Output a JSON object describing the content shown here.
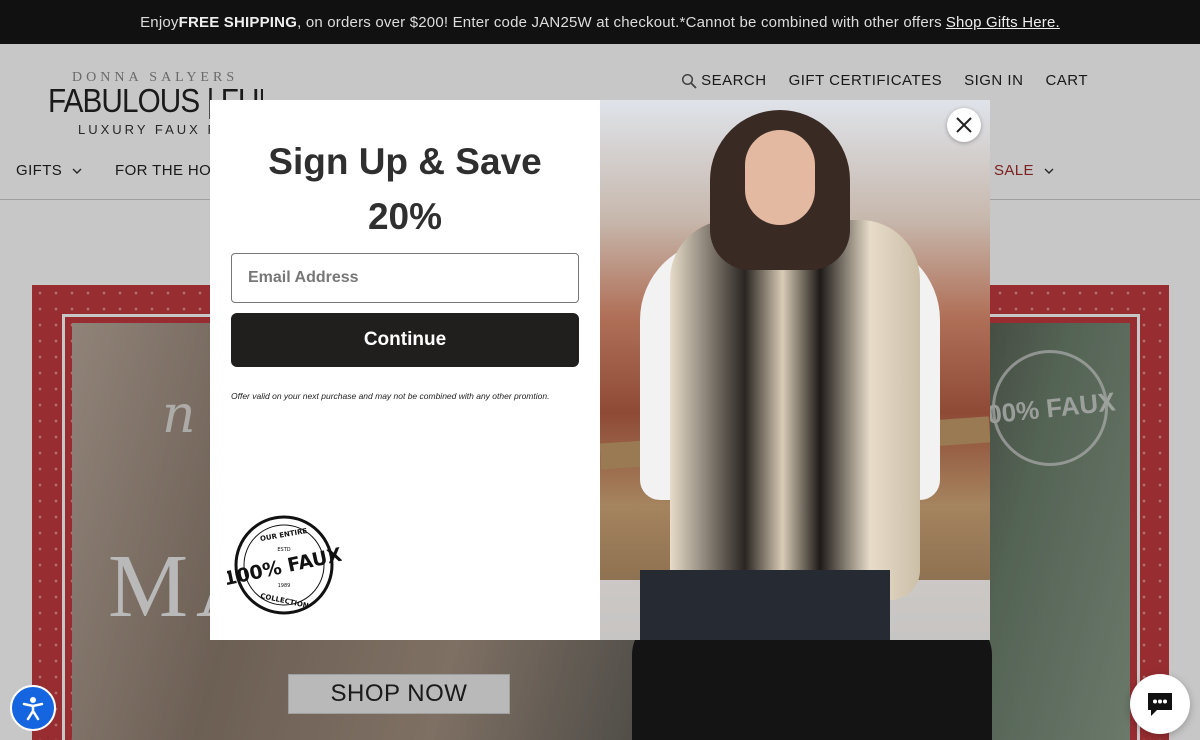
{
  "announcement": {
    "prefix": "Enjoy ",
    "bold": "FREE SHIPPING",
    "middle": ", on orders over $200! Enter code JAN25W at checkout.*Cannot be combined with other offers",
    "link": "Shop Gifts Here."
  },
  "logo": {
    "line1": "DONNA SALYERS",
    "line2": "FABULOUS | FURS",
    "line3": "LUXURY FAUX FURS"
  },
  "utility_nav": {
    "search": "SEARCH",
    "gift_certificates": "GIFT CERTIFICATES",
    "sign_in": "SIGN IN",
    "cart": "CART"
  },
  "main_nav": {
    "gifts": "GIFTS",
    "for_the_home": "FOR THE HO",
    "sale": "SALE"
  },
  "hero": {
    "script_text": "n",
    "headline": "MA",
    "shop_now": "SHOP NOW",
    "stamp_text": "00% FAUX"
  },
  "modal": {
    "title_line1": "Sign Up & Save",
    "title_line2": "20%",
    "email_placeholder": "Email Address",
    "continue_label": "Continue",
    "fine_print": "Offer valid on your next purchase and may not be combined with any other promtion.",
    "badge": {
      "top": "OUR ENTIRE",
      "estd": "ESTD",
      "main": "100% FAUX",
      "year": "1989",
      "bottom": "COLLECTION"
    }
  },
  "colors": {
    "announcement_bg": "#111111",
    "hero_red": "#c23a3f",
    "button_dark": "#211e1e",
    "sale_red": "#a02a2a",
    "accessibility_blue": "#1565e0"
  },
  "icons": {
    "search": "search-icon",
    "close": "close-icon",
    "chevron": "chevron-down-icon",
    "accessibility": "accessibility-icon",
    "chat": "chat-icon"
  }
}
